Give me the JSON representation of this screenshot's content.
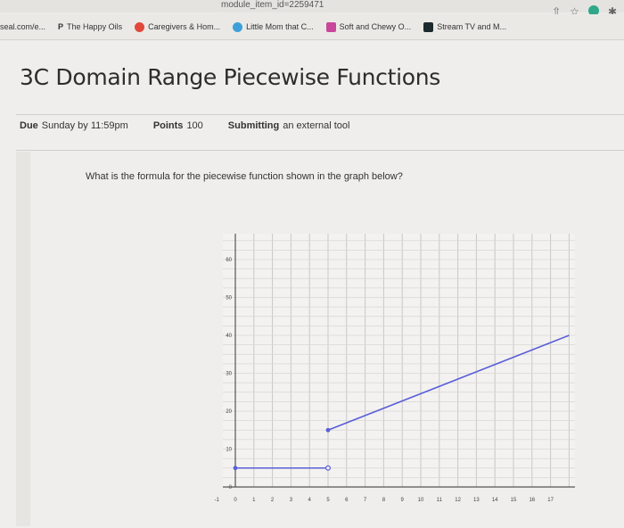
{
  "browser": {
    "url_fragment": "module_item_id=2259471",
    "bookmarks": [
      {
        "label": "seal.com/e...",
        "color": "#f0f0f0"
      },
      {
        "label": "The Happy Oils",
        "color": "#ffffff"
      },
      {
        "label": "Caregivers & Hom...",
        "color": "#e2483c"
      },
      {
        "label": "Little Mom that C...",
        "color": "#3ea0d8"
      },
      {
        "label": "Soft and Chewy O...",
        "color": "#c9479a"
      },
      {
        "label": "Stream TV and M...",
        "color": "#1d2a2e"
      }
    ]
  },
  "assignment": {
    "title": "3C Domain Range Piecewise Functions",
    "due_label": "Due",
    "due_value": "Sunday by 11:59pm",
    "points_label": "Points",
    "points_value": "100",
    "submitting_label": "Submitting",
    "submitting_value": "an external tool",
    "question": "What is the formula for the piecewise function shown in the graph below?"
  },
  "chart_data": {
    "type": "line",
    "x_ticks": [
      "-1",
      "0",
      "1",
      "2",
      "3",
      "4",
      "5",
      "6",
      "7",
      "8",
      "9",
      "10",
      "11",
      "12",
      "13",
      "14",
      "15",
      "16",
      "17"
    ],
    "y_ticks": [
      "0",
      "10",
      "20",
      "30",
      "40",
      "50",
      "60"
    ],
    "xlim": [
      -1,
      18
    ],
    "ylim": [
      0,
      65
    ],
    "grid": true,
    "series_color": "#5a5ed8",
    "segments": [
      {
        "x": [
          0,
          5
        ],
        "y": [
          5,
          5
        ],
        "start": "closed",
        "end": "open"
      },
      {
        "x": [
          5,
          18
        ],
        "y": [
          15,
          40
        ],
        "start": "closed",
        "end": "none"
      }
    ]
  }
}
